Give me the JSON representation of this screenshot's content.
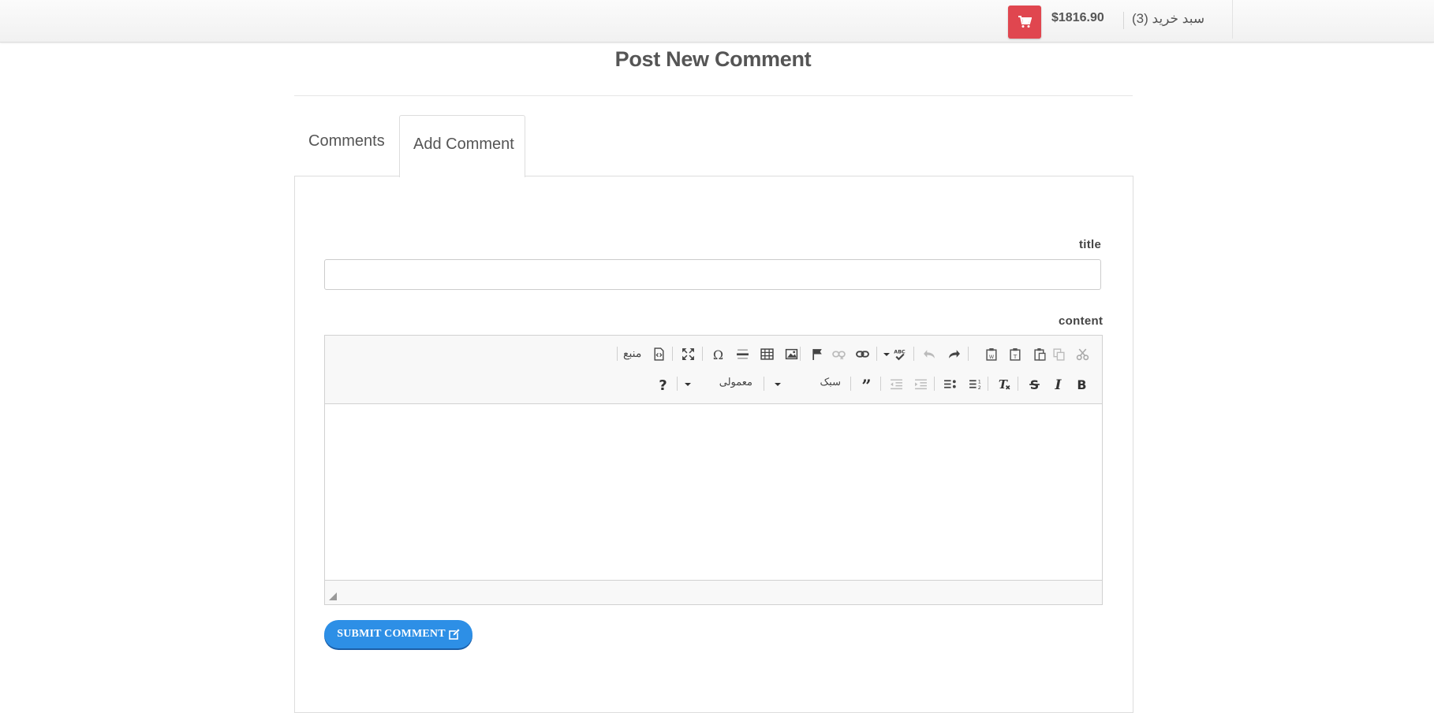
{
  "header": {
    "cart_label": "سبد خرید (3)",
    "cart_total": "$1816.90",
    "cart_icon": "shopping-cart-icon",
    "cart_button_color": "#e0464f"
  },
  "page": {
    "title": "Post New Comment"
  },
  "tabs": [
    {
      "label": "Comments",
      "active": false
    },
    {
      "label": "Add Comment",
      "active": true
    }
  ],
  "form": {
    "title_label": "title",
    "title_value": "",
    "content_label": "content",
    "submit_label": "SUBMIT COMMENT",
    "submit_color": "#2d8fe6"
  },
  "editor": {
    "source_label": "منبع",
    "styles_label": "سبک",
    "format_label": "معمولی",
    "toolbar_row1": [
      "cut-icon",
      "copy-icon",
      "paste-icon",
      "paste-text-icon",
      "paste-word-icon",
      "undo-icon",
      "redo-icon",
      "spellcheck-icon",
      "link-icon",
      "unlink-icon",
      "anchor-icon",
      "image-icon",
      "table-icon",
      "horizontal-rule-icon",
      "special-char-icon",
      "maximize-icon",
      "source-icon"
    ],
    "toolbar_row2": [
      "bold-icon",
      "italic-icon",
      "strike-icon",
      "remove-format-icon",
      "numbered-list-icon",
      "bulleted-list-icon",
      "outdent-icon",
      "indent-icon",
      "blockquote-icon",
      "help-icon"
    ]
  }
}
